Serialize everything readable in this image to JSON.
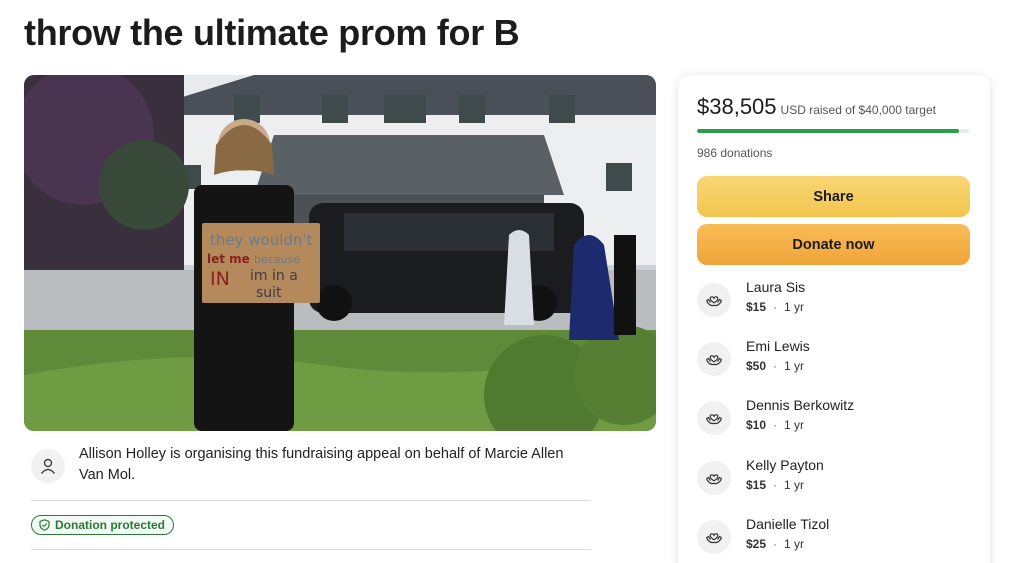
{
  "page": {
    "title": "throw the ultimate prom for B"
  },
  "hero": {
    "sign_lines": [
      "they wouldn't",
      "let me",
      "because",
      "IN",
      "im in a",
      "suit"
    ]
  },
  "organiser": {
    "text": "Allison Holley is organising this fundraising appeal on behalf of Marcie Allen Van Mol.",
    "icon": "person-icon"
  },
  "badge": {
    "label": "Donation protected",
    "icon": "shield-icon"
  },
  "donation_panel": {
    "amount": "$38,505",
    "target_text": "USD raised of $40,000 target",
    "progress_fraction": 0.963,
    "donations_count": "986 donations",
    "share_label": "Share",
    "donate_label": "Donate now",
    "colors": {
      "progress": "#2c9d4a",
      "share_button": "#f2c44e",
      "donate_button": "#f0a43a",
      "badge": "#2b7a3b"
    },
    "donors": [
      {
        "name": "Laura Sis",
        "amount": "$15",
        "time": "1 yr",
        "icon": "heart-hands-icon"
      },
      {
        "name": "Emi Lewis",
        "amount": "$50",
        "time": "1 yr",
        "icon": "heart-hands-icon"
      },
      {
        "name": "Dennis Berkowitz",
        "amount": "$10",
        "time": "1 yr",
        "icon": "heart-hands-icon"
      },
      {
        "name": "Kelly Payton",
        "amount": "$15",
        "time": "1 yr",
        "icon": "heart-hands-icon"
      },
      {
        "name": "Danielle Tizol",
        "amount": "$25",
        "time": "1 yr",
        "icon": "heart-hands-icon"
      }
    ]
  }
}
